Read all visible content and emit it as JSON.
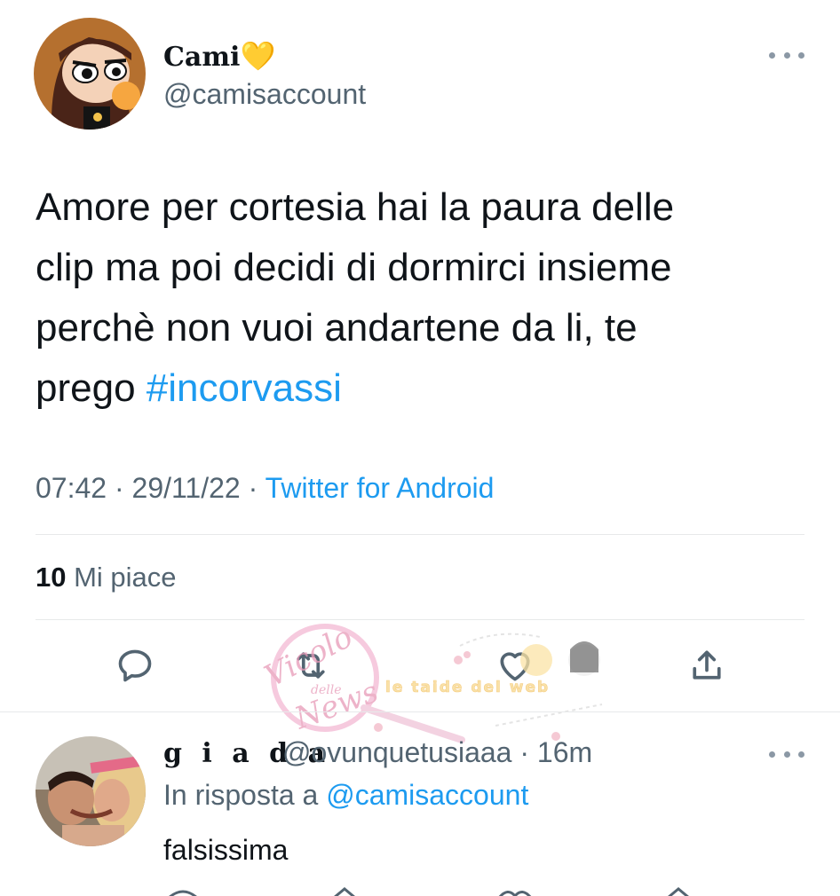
{
  "tweet": {
    "author": {
      "name": "Cami",
      "emoji": "💛",
      "handle": "@camisaccount",
      "avatar_icon": "cartoon-girl-avatar"
    },
    "text_lines": [
      "Amore per cortesia hai la paura delle",
      "clip ma poi decidi di dormirci insieme",
      "perchè non vuoi andartene da li, te",
      "prego "
    ],
    "hashtag": "#incorvassi",
    "time": "07:42",
    "separator": " · ",
    "date": "29/11/22",
    "source": "Twitter for Android",
    "likes_count": "10",
    "likes_label": "Mi piace",
    "actions": [
      "reply-icon",
      "retweet-icon",
      "like-icon",
      "share-icon"
    ]
  },
  "reply": {
    "name": "g i a d a",
    "handle": "@ovunquetusiaaa",
    "separator": " · ",
    "time": "16m",
    "replying_to_label": "In risposta a ",
    "replying_to_handle": "@camisaccount",
    "text": "falsissima",
    "avatar_icon": "selfie-photo-avatar"
  },
  "watermark": {
    "logo_text_top": "Vicolo",
    "logo_text_mid": "delle",
    "logo_text_bottom": "News",
    "banner_text": "le taide del web"
  },
  "colors": {
    "accent": "#1d9bf0",
    "secondary_text": "#536471",
    "primary_text": "#0f1419",
    "divider": "#e7e9ea",
    "heart_emoji": "#f7c83c"
  }
}
